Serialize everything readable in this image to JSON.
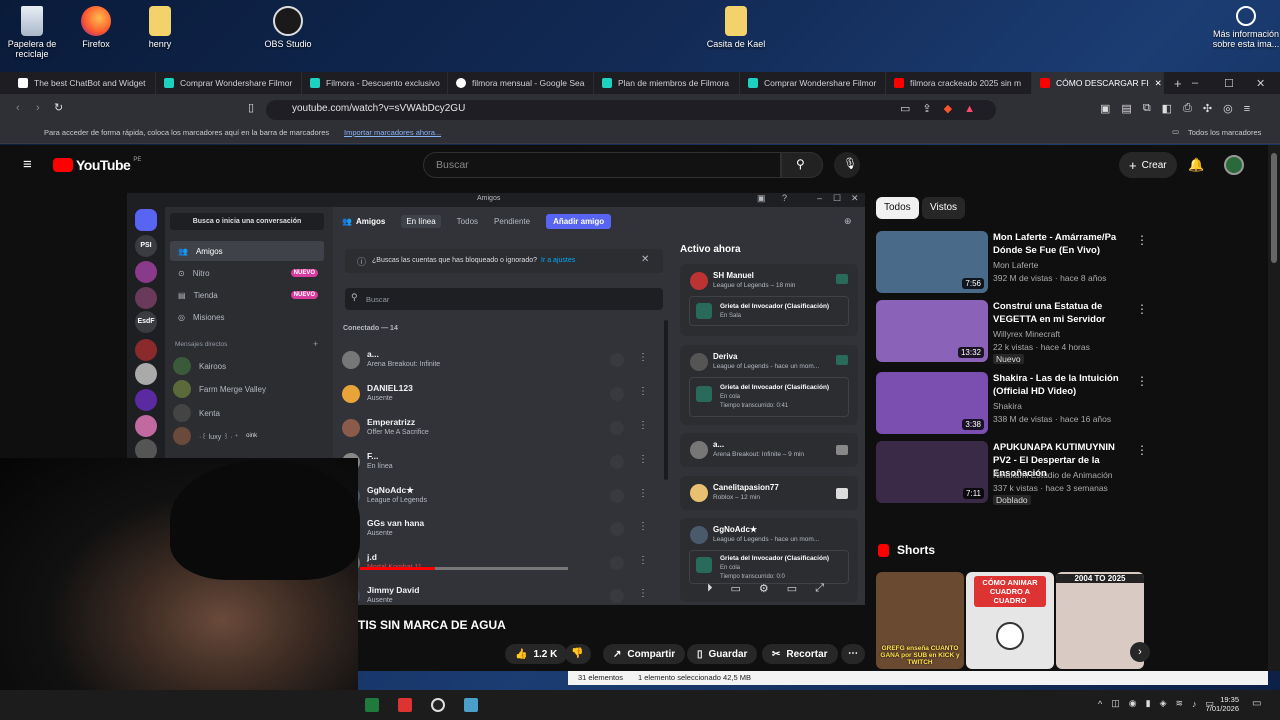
{
  "desktop": {
    "icons": [
      "Papelera de reciclaje",
      "Firefox",
      "henry",
      "OBS Studio",
      "Casita de Kael"
    ],
    "info": "Más información sobre esta ima..."
  },
  "browser": {
    "tabs": [
      "The best ChatBot and Widget",
      "Comprar Wondershare Filmor",
      "Filmora - Descuento exclusivo",
      "filmora mensual - Google Sea",
      "Plan de miembros de Filmora",
      "Comprar Wondershare Filmor",
      "filmora crackeado 2025 sin m",
      "CÓMO DESCARGAR FI"
    ],
    "url": "youtube.com/watch?v=sVWAbDcy2GU",
    "bookmarks_prompt": "Para acceder de forma rápida, coloca los marcadores aquí en la barra de marcadores",
    "bookmarks_link": "Importar marcadores ahora...",
    "all_bookmarks": "Todos los marcadores"
  },
  "youtube": {
    "logo": "YouTube",
    "region": "PE",
    "search_placeholder": "Buscar",
    "create": "Crear",
    "chips": [
      "Todos",
      "Vistos"
    ],
    "videos": [
      {
        "title": "Mon Laferte - Amárrame/Pa Dónde Se Fue (En Vivo)",
        "channel": "Mon Laferte",
        "meta": "392 M de vistas · hace 8 años",
        "duration": "7:56",
        "badge": "",
        "color": "#4a6a8a"
      },
      {
        "title": "Construí una Estatua de VEGETTA en mi Servidor",
        "channel": "Willyrex Minecraft",
        "meta": "22 k vistas · hace 4 horas",
        "duration": "13:32",
        "badge": "Nuevo",
        "color": "#8a63b8"
      },
      {
        "title": "Shakira - Las de la Intuición (Official HD Video)",
        "channel": "Shakira",
        "meta": "338 M de vistas · hace 16 años",
        "duration": "3:38",
        "badge": "",
        "color": "#7a4fb0"
      },
      {
        "title": "APUKUNAPA KUTIMUYNIN PV2 - El Despertar de la Ensoñación",
        "channel": "Ñinakami Estudio de Animación",
        "meta": "337 k vistas · hace 3 semanas",
        "duration": "7:11",
        "badge": "Doblado",
        "color": "#3a2a48"
      }
    ],
    "shorts_title": "Shorts",
    "shorts": [
      {
        "text": "GREFG enseña CUANTO GANA por SUB en KICK y TWITCH",
        "color": "#6b4a32"
      },
      {
        "text": "CÓMO ANIMAR CUADRO A CUADRO",
        "color": "#e6e6e6"
      },
      {
        "text": "2004 TO 2025",
        "color": "#d9cbc4"
      }
    ],
    "video_title": "TIS SIN MARCA DE AGUA",
    "likes": "1.2 K",
    "share": "Compartir",
    "save": "Guardar",
    "clip": "Recortar"
  },
  "discord": {
    "window_title": "Amigos",
    "search_conv": "Busca o inicia una conversación",
    "menu": [
      "Amigos",
      "Nitro",
      "Tienda",
      "Misiones"
    ],
    "new_badge": "NUEVO",
    "dm_header": "Mensajes directos",
    "dms": [
      "Kairoos",
      "Farm Merge Valley",
      "Kenta",
      "·꒰ luxy ꒱ ∙ ⁺"
    ],
    "dm_badge": "oink",
    "guild_labels": [
      "PSI",
      "EsdF"
    ],
    "tabs": {
      "friends": "Amigos",
      "online": "En línea",
      "all": "Todos",
      "pending": "Pendiente",
      "add": "Añadir amigo"
    },
    "notice": "¿Buscas las cuentas que has bloqueado o ignorado?",
    "notice_link": "Ir a ajustes",
    "search": "Buscar",
    "connected": "Conectado — 14",
    "friends": [
      {
        "name": "a...",
        "status": "Arena Breakout: Infinite",
        "color": "#777"
      },
      {
        "name": "DANIEL123",
        "status": "Ausente",
        "color": "#e8a33a"
      },
      {
        "name": "Emperatrizz",
        "status": "Offer Me A Sacrifice",
        "color": "#8a5a4a"
      },
      {
        "name": "F...",
        "status": "En línea",
        "color": "#888"
      },
      {
        "name": "GgNoAdc★",
        "status": "League of Legends",
        "color": "#4a5a6a"
      },
      {
        "name": "GGs van hana",
        "status": "Ausente",
        "color": "#5a3a2a"
      },
      {
        "name": "j.d",
        "status": "Mortal Kombat 11",
        "color": "#6a6a6a"
      },
      {
        "name": "Jimmy David",
        "status": "Ausente",
        "color": "#3a4a5a"
      }
    ],
    "active_title": "Activo ahora",
    "active": [
      {
        "name": "SH Manuel",
        "line": "League of Legends – 18 min",
        "game": "Grieta del Invocador (Clasificación)",
        "sub": "En Sala",
        "sub2": ""
      },
      {
        "name": "Deriva",
        "line": "League of Legends - hace un mom...",
        "game": "Grieta del Invocador (Clasificación)",
        "sub": "En cola",
        "sub2": "Tiempo transcurrido: 0:41"
      },
      {
        "name": "a...",
        "line": "Arena Breakout: Infinite – 9 min",
        "game": "",
        "sub": "",
        "sub2": ""
      },
      {
        "name": "Canelitapasion77",
        "line": "Roblox – 12 min",
        "game": "",
        "sub": "",
        "sub2": ""
      },
      {
        "name": "GgNoAdc★",
        "line": "League of Legends - hace un mom...",
        "game": "Grieta del Invocador (Clasificación)",
        "sub": "En cola",
        "sub2": "Tiempo transcurrido: 0:0"
      }
    ]
  },
  "statusbar": {
    "items": "31 elementos",
    "selected": "1 elemento seleccionado  42,5 MB"
  },
  "taskbar": {
    "time": "19:35",
    "date": "7/01/2026"
  }
}
